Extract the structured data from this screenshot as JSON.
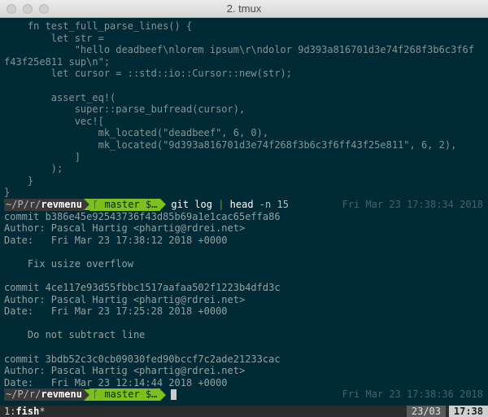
{
  "window": {
    "title": "2. tmux"
  },
  "top_pane": {
    "lines": [
      "    fn test_full_parse_lines() {",
      "        let str =",
      "            \"hello deadbeef\\nlorem ipsum\\r\\ndolor 9d393a816701d3e74f268f3b6c3f6f",
      "f43f25e811 sup\\n\";",
      "        let cursor = ::std::io::Cursor::new(str);",
      "",
      "        assert_eq!(",
      "            super::parse_bufread(cursor),",
      "            vec![",
      "                mk_located(\"deadbeef\", 6, 0),",
      "                mk_located(\"9d393a816701d3e74f268f3b6c3f6ff43f25e811\", 6, 2),",
      "            ]",
      "        );",
      "    }",
      "}"
    ]
  },
  "prompt1": {
    "path_prefix": "~/P/r/",
    "path_dir": "revmenu",
    "git": "ᚴ master $…",
    "command_kw": "git",
    "command_args1": " log ",
    "pipe": "|",
    "command_args2": " head ",
    "flag": "-n 15",
    "time": "Fri Mar 23 17:38:34 2018"
  },
  "git_log": {
    "lines": [
      "commit b386e45e92543736f43d85b69a1e1cac65effa86",
      "Author: Pascal Hartig <phartig@rdrei.net>",
      "Date:   Fri Mar 23 17:38:12 2018 +0000",
      "",
      "    Fix usize overflow",
      "",
      "commit 4ce117e93d55fbbc1517aafaa502f1223b4dfd3c",
      "Author: Pascal Hartig <phartig@rdrei.net>",
      "Date:   Fri Mar 23 17:25:28 2018 +0000",
      "",
      "    Do not subtract line",
      "",
      "commit 3bdb52c3c0cb09030fed90bccf7c2ade21233cac",
      "Author: Pascal Hartig <phartig@rdrei.net>",
      "Date:   Fri Mar 23 12:14:44 2018 +0000"
    ]
  },
  "prompt2": {
    "path_prefix": "~/P/r/",
    "path_dir": "revmenu",
    "git": "ᚴ master $…",
    "time": "Fri Mar 23 17:38:36 2018"
  },
  "statusbar": {
    "window_index": "1:",
    "window_name": "fish",
    "active_marker": "*",
    "date": "23/03",
    "time": "17:38"
  }
}
